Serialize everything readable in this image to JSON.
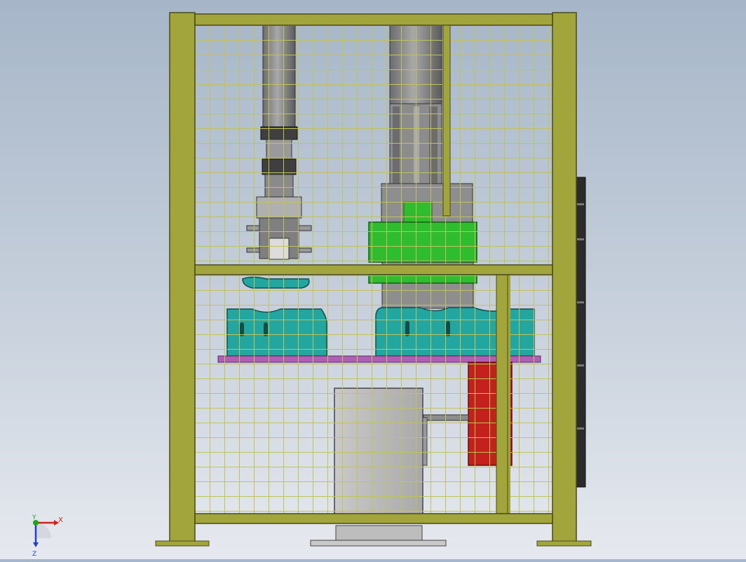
{
  "viewport": {
    "view": "front",
    "background": [
      "#a6b6c8",
      "#e6e9ef"
    ]
  },
  "colors": {
    "frame": "#a2a53c",
    "frame_edge": "#4a4a18",
    "mesh": "#c2c25a",
    "motor_gray": "#8f8f8f",
    "motor_dark": "#5e5e5e",
    "green_block": "#2fbd2f",
    "cyan_fixture": "#23a6a0",
    "purple_plate": "#b05fb5",
    "red_block": "#c4201c",
    "cabinet": "#b9b9b9",
    "side_rail": "#2b2b2b"
  },
  "components": [
    "outer-frame",
    "wire-mesh-guard",
    "left-servo-motor",
    "right-motor-assembly",
    "green-mount-block",
    "cyan-fixture-left",
    "cyan-fixture-right",
    "purple-base-plate",
    "red-cylinder-block",
    "gray-control-cabinet",
    "side-rail"
  ],
  "axis_triad": {
    "x_label": "X",
    "y_label": "Y",
    "z_label": "Z",
    "x_color": "#d0211a",
    "y_color": "#1fa51f",
    "z_color": "#1f3fd0"
  }
}
